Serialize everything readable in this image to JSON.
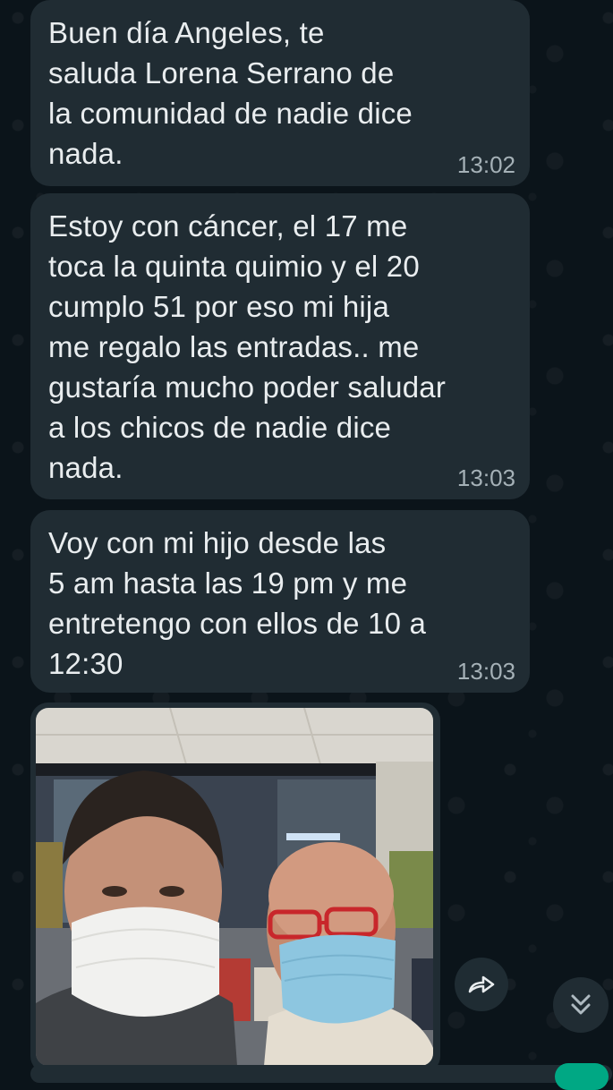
{
  "messages": [
    {
      "text": "Buen día Angeles, te\nsaluda  Lorena Serrano de\nla comunidad de nadie dice\nnada.",
      "time": "13:02"
    },
    {
      "text": "Estoy con cáncer, el 17 me\ntoca la quinta quimio y el 20\ncumplo 51 por eso mi hija\nme regalo las entradas..  me\ngustaría mucho poder saludar\na los chicos de nadie dice\nnada.",
      "time": "13:03"
    },
    {
      "text": "Voy con mi hijo desde las\n5 am hasta las 19 pm y me\nentretengo con ellos de 10 a\n12:30",
      "time": "13:03"
    }
  ],
  "icons": {
    "forward": "forward-icon",
    "scroll_down": "double-chevron-down-icon"
  },
  "colors": {
    "background": "#0b141a",
    "bubble": "#202c33",
    "text": "#e9edef",
    "timestamp": "#a5b1b7",
    "accent": "#00a884"
  }
}
